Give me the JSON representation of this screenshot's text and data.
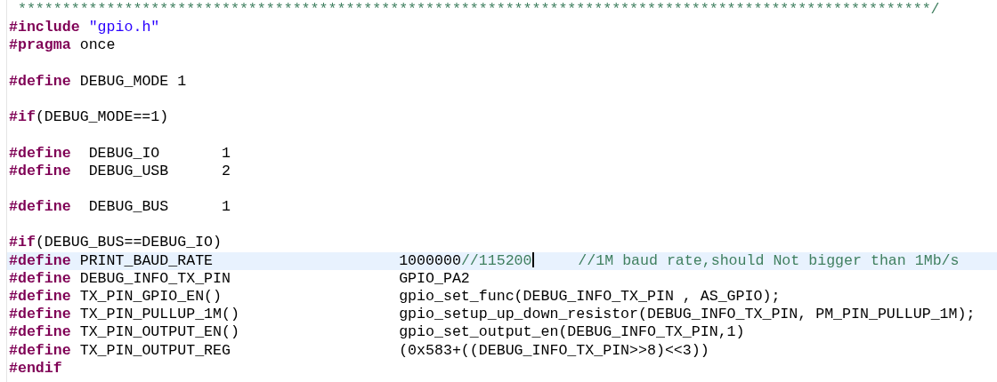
{
  "lines": [
    {
      "current": false,
      "tokens": [
        {
          "kind": "comment",
          "text": " *******************************************************************************************************/"
        }
      ]
    },
    {
      "current": false,
      "tokens": [
        {
          "kind": "keyword",
          "text": "#include"
        },
        {
          "kind": "string",
          "text": " \"gpio.h\""
        }
      ]
    },
    {
      "current": false,
      "tokens": [
        {
          "kind": "keyword",
          "text": "#pragma"
        },
        {
          "kind": "plain",
          "text": " once"
        }
      ]
    },
    {
      "current": false
    },
    {
      "current": false,
      "tokens": [
        {
          "kind": "keyword",
          "text": "#define"
        },
        {
          "kind": "plain",
          "text": " DEBUG_MODE 1"
        }
      ]
    },
    {
      "current": false
    },
    {
      "current": false,
      "tokens": [
        {
          "kind": "keyword",
          "text": "#if"
        },
        {
          "kind": "plain",
          "text": "(DEBUG_MODE==1)"
        }
      ]
    },
    {
      "current": false
    },
    {
      "current": false,
      "tokens": [
        {
          "kind": "keyword",
          "text": "#define"
        },
        {
          "kind": "plain",
          "text": "  DEBUG_IO       1"
        }
      ]
    },
    {
      "current": false,
      "tokens": [
        {
          "kind": "keyword",
          "text": "#define"
        },
        {
          "kind": "plain",
          "text": "  DEBUG_USB      2"
        }
      ]
    },
    {
      "current": false
    },
    {
      "current": false,
      "tokens": [
        {
          "kind": "keyword",
          "text": "#define"
        },
        {
          "kind": "plain",
          "text": "  DEBUG_BUS      1"
        }
      ]
    },
    {
      "current": false
    },
    {
      "current": false,
      "tokens": [
        {
          "kind": "keyword",
          "text": "#if"
        },
        {
          "kind": "plain",
          "text": "(DEBUG_BUS==DEBUG_IO)"
        }
      ]
    },
    {
      "current": true,
      "tokens": [
        {
          "kind": "keyword",
          "text": "#define"
        },
        {
          "kind": "plain",
          "text": " PRINT_BAUD_RATE                     1000000"
        },
        {
          "kind": "comment",
          "text": "//115200"
        },
        {
          "kind": "cursor"
        },
        {
          "kind": "comment",
          "text": "     //1M baud rate,should Not bigger than 1Mb/s"
        }
      ]
    },
    {
      "current": false,
      "tokens": [
        {
          "kind": "keyword",
          "text": "#define"
        },
        {
          "kind": "plain",
          "text": " DEBUG_INFO_TX_PIN                   GPIO_PA2"
        }
      ]
    },
    {
      "current": false,
      "tokens": [
        {
          "kind": "keyword",
          "text": "#define"
        },
        {
          "kind": "plain",
          "text": " TX_PIN_GPIO_EN()                    gpio_set_func(DEBUG_INFO_TX_PIN , AS_GPIO);"
        }
      ]
    },
    {
      "current": false,
      "tokens": [
        {
          "kind": "keyword",
          "text": "#define"
        },
        {
          "kind": "plain",
          "text": " TX_PIN_PULLUP_1M()                  gpio_setup_up_down_resistor(DEBUG_INFO_TX_PIN, PM_PIN_PULLUP_1M);"
        }
      ]
    },
    {
      "current": false,
      "tokens": [
        {
          "kind": "keyword",
          "text": "#define"
        },
        {
          "kind": "plain",
          "text": " TX_PIN_OUTPUT_EN()                  gpio_set_output_en(DEBUG_INFO_TX_PIN,1)"
        }
      ]
    },
    {
      "current": false,
      "tokens": [
        {
          "kind": "keyword",
          "text": "#define"
        },
        {
          "kind": "plain",
          "text": " TX_PIN_OUTPUT_REG                   (0x583+((DEBUG_INFO_TX_PIN>>8)<<3))"
        }
      ]
    },
    {
      "current": false,
      "tokens": [
        {
          "kind": "keyword",
          "text": "#endif"
        }
      ]
    }
  ]
}
